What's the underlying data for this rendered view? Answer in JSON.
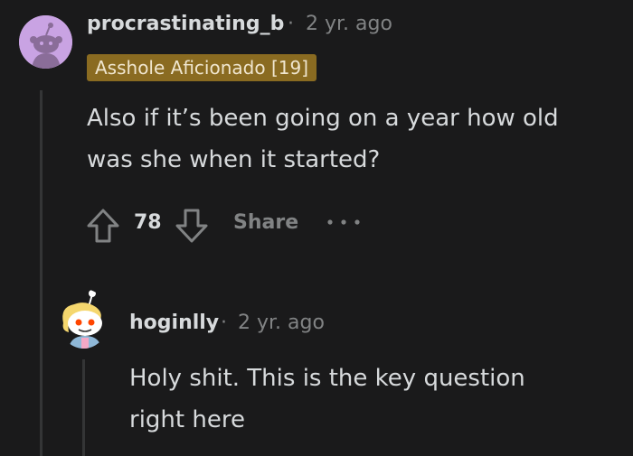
{
  "comments": [
    {
      "username": "procrastinating_b",
      "separator": "·",
      "time": "2 yr. ago",
      "flair": "Asshole Aficionado [19]",
      "body_line1": "Also if it’s been going on a year how old",
      "body_line2": "was she when it started?",
      "score": "78",
      "share_label": "Share",
      "avatar_icon": "snoo-avatar-icon"
    },
    {
      "username": "hoginlly",
      "separator": "·",
      "time": "2 yr. ago",
      "body_line1": "Holy shit. This is the key question",
      "body_line2": "right here",
      "avatar_icon": "snoo-avatar-icon"
    }
  ],
  "icons": {
    "upvote": "upvote-arrow-icon",
    "downvote": "downvote-arrow-icon",
    "more": "more-options-icon"
  },
  "colors": {
    "background": "#1a1a1b",
    "text": "#d7dadc",
    "muted": "#818384",
    "flair_bg": "#8a6b21",
    "avatar1_bg": "#c9a3e3"
  }
}
